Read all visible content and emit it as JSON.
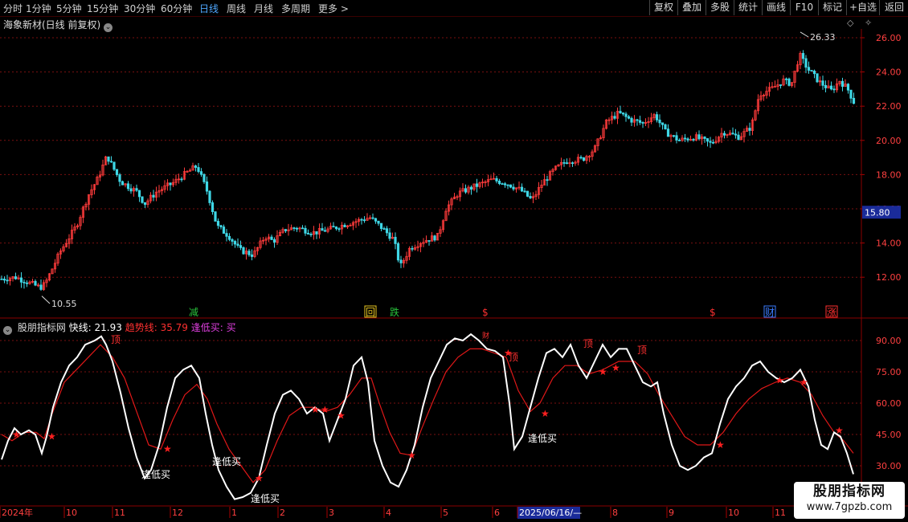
{
  "toolbar": {
    "periods": [
      "分时",
      "1分钟",
      "5分钟",
      "15分钟",
      "30分钟",
      "60分钟",
      "日线",
      "周线",
      "月线",
      "多周期",
      "更多"
    ],
    "active_period": "日线",
    "right_buttons": [
      "复权",
      "叠加",
      "多股",
      "统计",
      "画线",
      "F10",
      "标记",
      "+自选",
      "返回"
    ]
  },
  "main_chart": {
    "title": "海象新材(日线 前复权)",
    "high_label": "26.33",
    "low_label": "10.55",
    "price_axis": [
      "26.00",
      "24.00",
      "22.00",
      "20.00",
      "18.00",
      "16.00",
      "14.00",
      "12.00"
    ],
    "current_price": "15.80",
    "markers": [
      {
        "label": "减",
        "color": "#29c23b"
      },
      {
        "label": "回",
        "color": "#e8c620"
      },
      {
        "label": "跌",
        "color": "#29c23b"
      },
      {
        "label": "$",
        "color": "#ff3030"
      },
      {
        "label": "$",
        "color": "#ff3030"
      },
      {
        "label": "财",
        "color": "#3a7bff"
      },
      {
        "label": "涨",
        "color": "#ff3030"
      }
    ]
  },
  "indicator": {
    "name": "股朋指标网",
    "fast_label": "快线: 21.93",
    "trend_label": "趋势线: 35.79",
    "buy_label": "逢低买: 买",
    "axis": [
      "90.00",
      "75.00",
      "60.00",
      "45.00",
      "30.00"
    ],
    "top_labels": [
      "顶",
      "顶",
      "顶",
      "顶"
    ],
    "buy_text": "逢低买",
    "tiny_label": "财"
  },
  "time_axis": [
    "2024年",
    "10",
    "11",
    "12",
    "1",
    "2",
    "3",
    "4",
    "5",
    "6",
    "2025/06/16/—",
    "8",
    "9",
    "10",
    "11"
  ],
  "watermark": {
    "title": "股朋指标网",
    "url": "www.7gpzb.com"
  },
  "colors": {
    "up": "#ff3b3b",
    "down": "#3fd7e6",
    "fast": "#ffffff",
    "trend": "#e01818",
    "grid": "#7a1010"
  }
}
